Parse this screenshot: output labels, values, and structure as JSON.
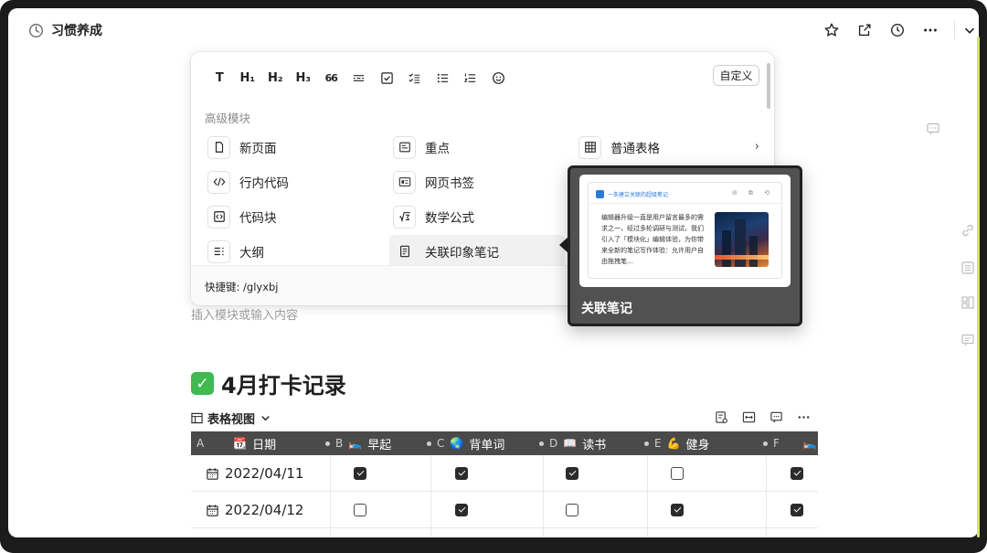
{
  "window": {
    "title": "习惯养成",
    "icon": "clock-icon"
  },
  "toolbar": {
    "actions": [
      "star-icon",
      "share-out-icon",
      "history-icon",
      "more-icon",
      "chevron-down-icon"
    ]
  },
  "insert_menu": {
    "format_buttons": [
      {
        "name": "text-format",
        "label": "T"
      },
      {
        "name": "heading1",
        "label": "H₁"
      },
      {
        "name": "heading2",
        "label": "H₂"
      },
      {
        "name": "heading3",
        "label": "H₃"
      },
      {
        "name": "quote",
        "label": "66"
      },
      {
        "name": "divider",
        "label": ""
      },
      {
        "name": "checkbox",
        "label": ""
      },
      {
        "name": "checklist",
        "label": ""
      },
      {
        "name": "bullet-list",
        "label": ""
      },
      {
        "name": "numbered-list",
        "label": ""
      },
      {
        "name": "emoji",
        "label": ""
      }
    ],
    "custom_label": "自定义",
    "section_title": "高级模块",
    "items": [
      {
        "label": "新页面",
        "icon": "page-icon"
      },
      {
        "label": "重点",
        "icon": "highlight-icon"
      },
      {
        "label": "普通表格",
        "icon": "table-icon"
      },
      {
        "label": "行内代码",
        "icon": "inline-code-icon"
      },
      {
        "label": "网页书签",
        "icon": "bookmark-icon"
      },
      {
        "label": "代码块",
        "icon": "code-block-icon"
      },
      {
        "label": "数学公式",
        "icon": "formula-icon"
      },
      {
        "label": "大纲",
        "icon": "outline-icon"
      },
      {
        "label": "关联印象笔记",
        "icon": "linked-note-icon"
      }
    ],
    "shortcut": "快捷键: /glyxbj"
  },
  "preview": {
    "header": "一条建立关联的超级笔记",
    "body": "编辑器升级一直是用户留言最多的需求之一，经过多轮调研与测试，我们引入了「模块化」编辑体验，为你带来全新的笔记写作体验：允许用户自由拖拽笔…",
    "caption": "关联笔记"
  },
  "editor": {
    "placeholder": "插入模块或输入内容"
  },
  "section": {
    "heading_emoji": "✓",
    "heading": "4月打卡记录"
  },
  "table_view": {
    "label": "表格视图"
  },
  "table": {
    "columns": [
      {
        "letter": "A",
        "emoji": "📆",
        "name": "日期"
      },
      {
        "letter": "B",
        "emoji": "🛌",
        "name": "早起"
      },
      {
        "letter": "C",
        "emoji": "🌏",
        "name": "背单词"
      },
      {
        "letter": "D",
        "emoji": "📖",
        "name": "读书"
      },
      {
        "letter": "E",
        "emoji": "💪",
        "name": "健身"
      },
      {
        "letter": "F",
        "emoji": "🛌",
        "name": ""
      }
    ],
    "rows": [
      {
        "date": "2022/04/11",
        "values": [
          true,
          true,
          true,
          false,
          true
        ]
      },
      {
        "date": "2022/04/12",
        "values": [
          false,
          true,
          false,
          true,
          true
        ]
      }
    ]
  }
}
